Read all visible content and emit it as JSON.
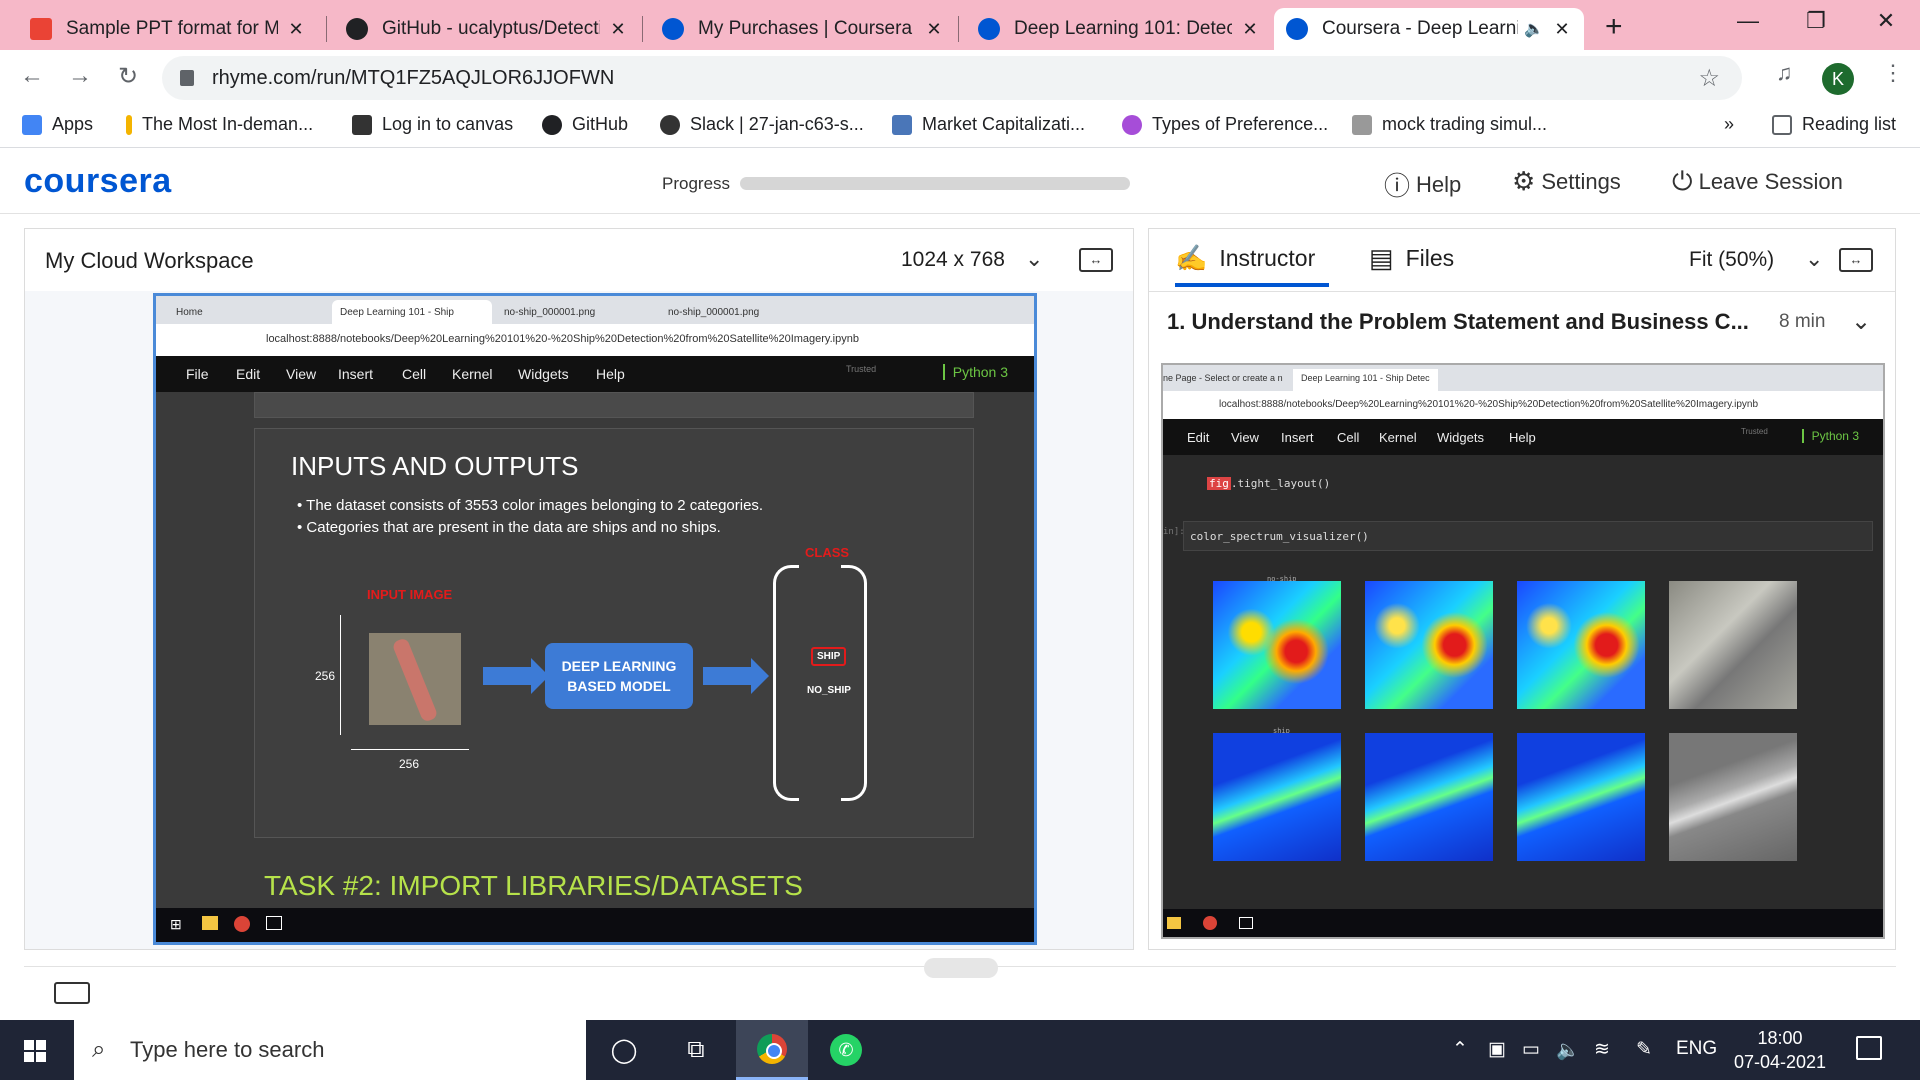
{
  "browser": {
    "tabs": [
      {
        "title": "Sample PPT format for Maj",
        "favicon_color": "#ea4335"
      },
      {
        "title": "GitHub - ucalyptus/Detecti",
        "favicon_color": "#202124"
      },
      {
        "title": "My Purchases | Coursera",
        "favicon_color": "#0056d2"
      },
      {
        "title": "Deep Learning 101: Detect",
        "favicon_color": "#0056d2"
      },
      {
        "title": "Coursera - Deep Learni",
        "favicon_color": "#0056d2"
      }
    ],
    "url": "rhyme.com/run/MTQ1FZ5AQJLOR6JJOFWN",
    "avatar_letter": "K",
    "bookmarks": [
      {
        "label": "Apps",
        "color": "#4285f4"
      },
      {
        "label": "The Most In-deman...",
        "color": "#f4b400"
      },
      {
        "label": "Log in to canvas",
        "color": "#333333"
      },
      {
        "label": "GitHub",
        "color": "#202124"
      },
      {
        "label": "Slack | 27-jan-c63-s...",
        "color": "#333333"
      },
      {
        "label": "Market Capitalizati...",
        "color": "#4a76b8"
      },
      {
        "label": "Types of Preference...",
        "color": "#a64dd8"
      },
      {
        "label": "mock trading simul...",
        "color": "#999999"
      }
    ],
    "more_bookmarks": "»",
    "reading_list": "Reading list"
  },
  "header": {
    "logo": "coursera",
    "progress_label": "Progress",
    "progress": 0,
    "help": "Help",
    "settings": "Settings",
    "leave": "Leave Session"
  },
  "workspace": {
    "title": "My Cloud Workspace",
    "resolution": "1024 x 768",
    "remote": {
      "tabs": [
        "Home",
        "Deep Learning 101 - Ship",
        "no-ship_000001.png",
        "no-ship_000001.png"
      ],
      "url": "localhost:8888/notebooks/Deep%20Learning%20101%20-%20Ship%20Detection%20from%20Satellite%20Imagery.ipynb",
      "menu": [
        "File",
        "Edit",
        "View",
        "Insert",
        "Cell",
        "Kernel",
        "Widgets",
        "Help"
      ],
      "trusted": "Trusted",
      "kernel": "Python 3",
      "slide": {
        "title": "INPUTS AND OUTPUTS",
        "bullets": [
          "The dataset consists of  3553 color images belonging to 2 categories.",
          "Categories that are present in the data are ships and no ships."
        ],
        "class_label": "CLASS",
        "input_label": "INPUT IMAGE",
        "height_dim": "256",
        "width_dim": "256",
        "model_line1": "DEEP LEARNING",
        "model_line2": "BASED MODEL",
        "class_ship": "SHIP",
        "class_noship": "NO_SHIP"
      },
      "task_heading": "TASK #2: IMPORT LIBRARIES/DATASETS"
    }
  },
  "instructor": {
    "tab_instructor": "Instructor",
    "tab_files": "Files",
    "fit": "Fit (50%)",
    "section_title": "1. Understand the Problem Statement and Business C...",
    "duration": "8 min",
    "video": {
      "tab1": "ne Page - Select or create a n",
      "tab2": "Deep Learning 101 - Ship Detec",
      "url": "localhost:8888/notebooks/Deep%20Learning%20101%20-%20Ship%20Detection%20from%20Satellite%20Imagery.ipynb",
      "menu": [
        "Edit",
        "View",
        "Insert",
        "Cell",
        "Kernel",
        "Widgets",
        "Help"
      ],
      "trusted": "Trusted",
      "kernel": "Python 3",
      "code1_kw": "fig",
      "code1_rest": ".tight_layout()",
      "prompt": "in]:",
      "code2": "color_spectrum_visualizer()",
      "row1_label": "no-ship",
      "row2_label": "ship"
    }
  },
  "taskbar": {
    "search_placeholder": "Type here to search",
    "language": "ENG",
    "time": "18:00",
    "date": "07-04-2021"
  }
}
